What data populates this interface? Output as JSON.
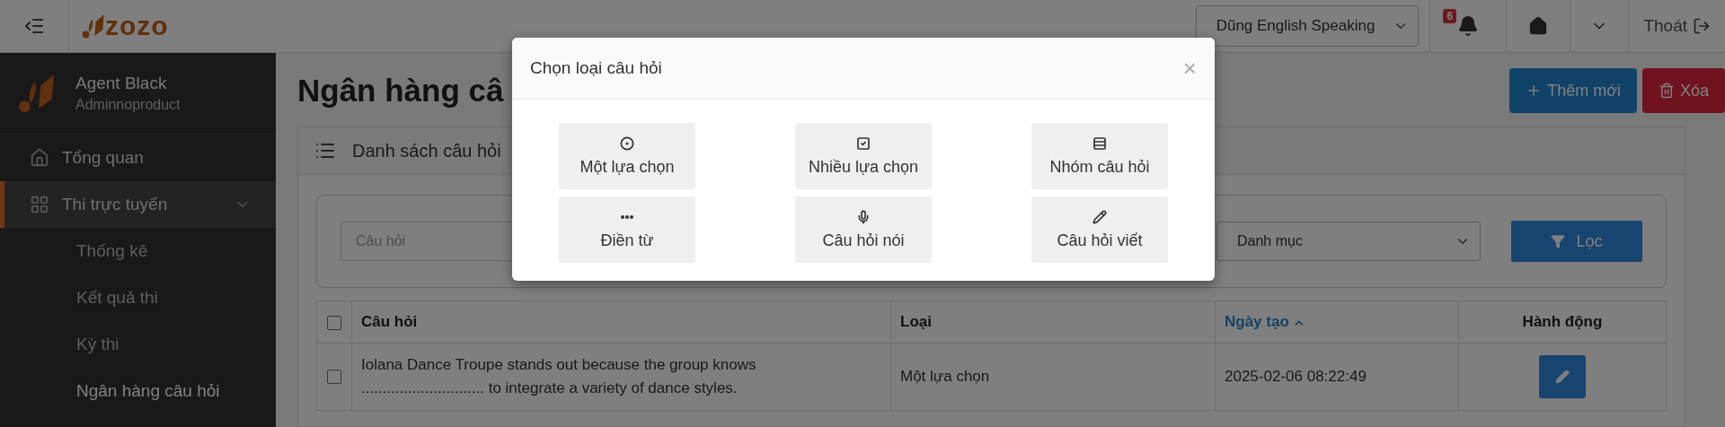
{
  "topbar": {
    "logo": "zozo",
    "account_select": {
      "value": "Dũng English Speaking"
    },
    "notifications": {
      "count": "6"
    },
    "logout": "Thoát"
  },
  "sidebar": {
    "user": {
      "name": "Agent Black",
      "role": "Adminnoproduct"
    },
    "items": [
      {
        "label": "Tổng quan",
        "kind": "home",
        "selected": false
      },
      {
        "label": "Thi trực tuyến",
        "kind": "grid",
        "selected": true,
        "expanded": true,
        "children": [
          {
            "label": "Thống kê",
            "selected": false
          },
          {
            "label": "Kết quả thi",
            "selected": false
          },
          {
            "label": "Kỳ thi",
            "selected": false
          },
          {
            "label": "Ngân hàng câu hỏi",
            "selected": true
          }
        ]
      }
    ]
  },
  "page": {
    "title": "Ngân hàng câ",
    "actions": [
      {
        "label": "Thêm mới",
        "kind": "add"
      },
      {
        "label": "Xóa",
        "kind": "delete"
      }
    ],
    "card_title": "Danh sách câu hỏi",
    "filters": {
      "search": {
        "placeholder": "Câu hỏi"
      },
      "category": {
        "value": "Danh mục"
      },
      "button": "Lọc"
    },
    "table": {
      "all_checked": false,
      "columns": [
        {
          "label": "Câu hỏi",
          "sorted": false
        },
        {
          "label": "Loại",
          "sorted": false
        },
        {
          "label": "Ngày tạo",
          "sorted": true
        },
        {
          "label": "Hành động",
          "sorted": false
        }
      ],
      "rows": [
        {
          "checked": false,
          "question": "Iolana Dance Troupe stands out because the group knows ............................. to integrate a variety of dance styles.",
          "type": "Một lựa chọn",
          "created": "2025-02-06 08:22:49"
        }
      ]
    }
  },
  "modal": {
    "title": "Chọn loại câu hỏi",
    "close": "×",
    "options": [
      {
        "label": "Một lựa chọn",
        "kind": "single"
      },
      {
        "label": "Nhiều lựa chọn",
        "kind": "multiple"
      },
      {
        "label": "Nhóm câu hỏi",
        "kind": "group"
      },
      {
        "label": "Điền từ",
        "kind": "fill"
      },
      {
        "label": "Câu hỏi nói",
        "kind": "speaking"
      },
      {
        "label": "Câu hỏi viết",
        "kind": "writing"
      }
    ]
  }
}
